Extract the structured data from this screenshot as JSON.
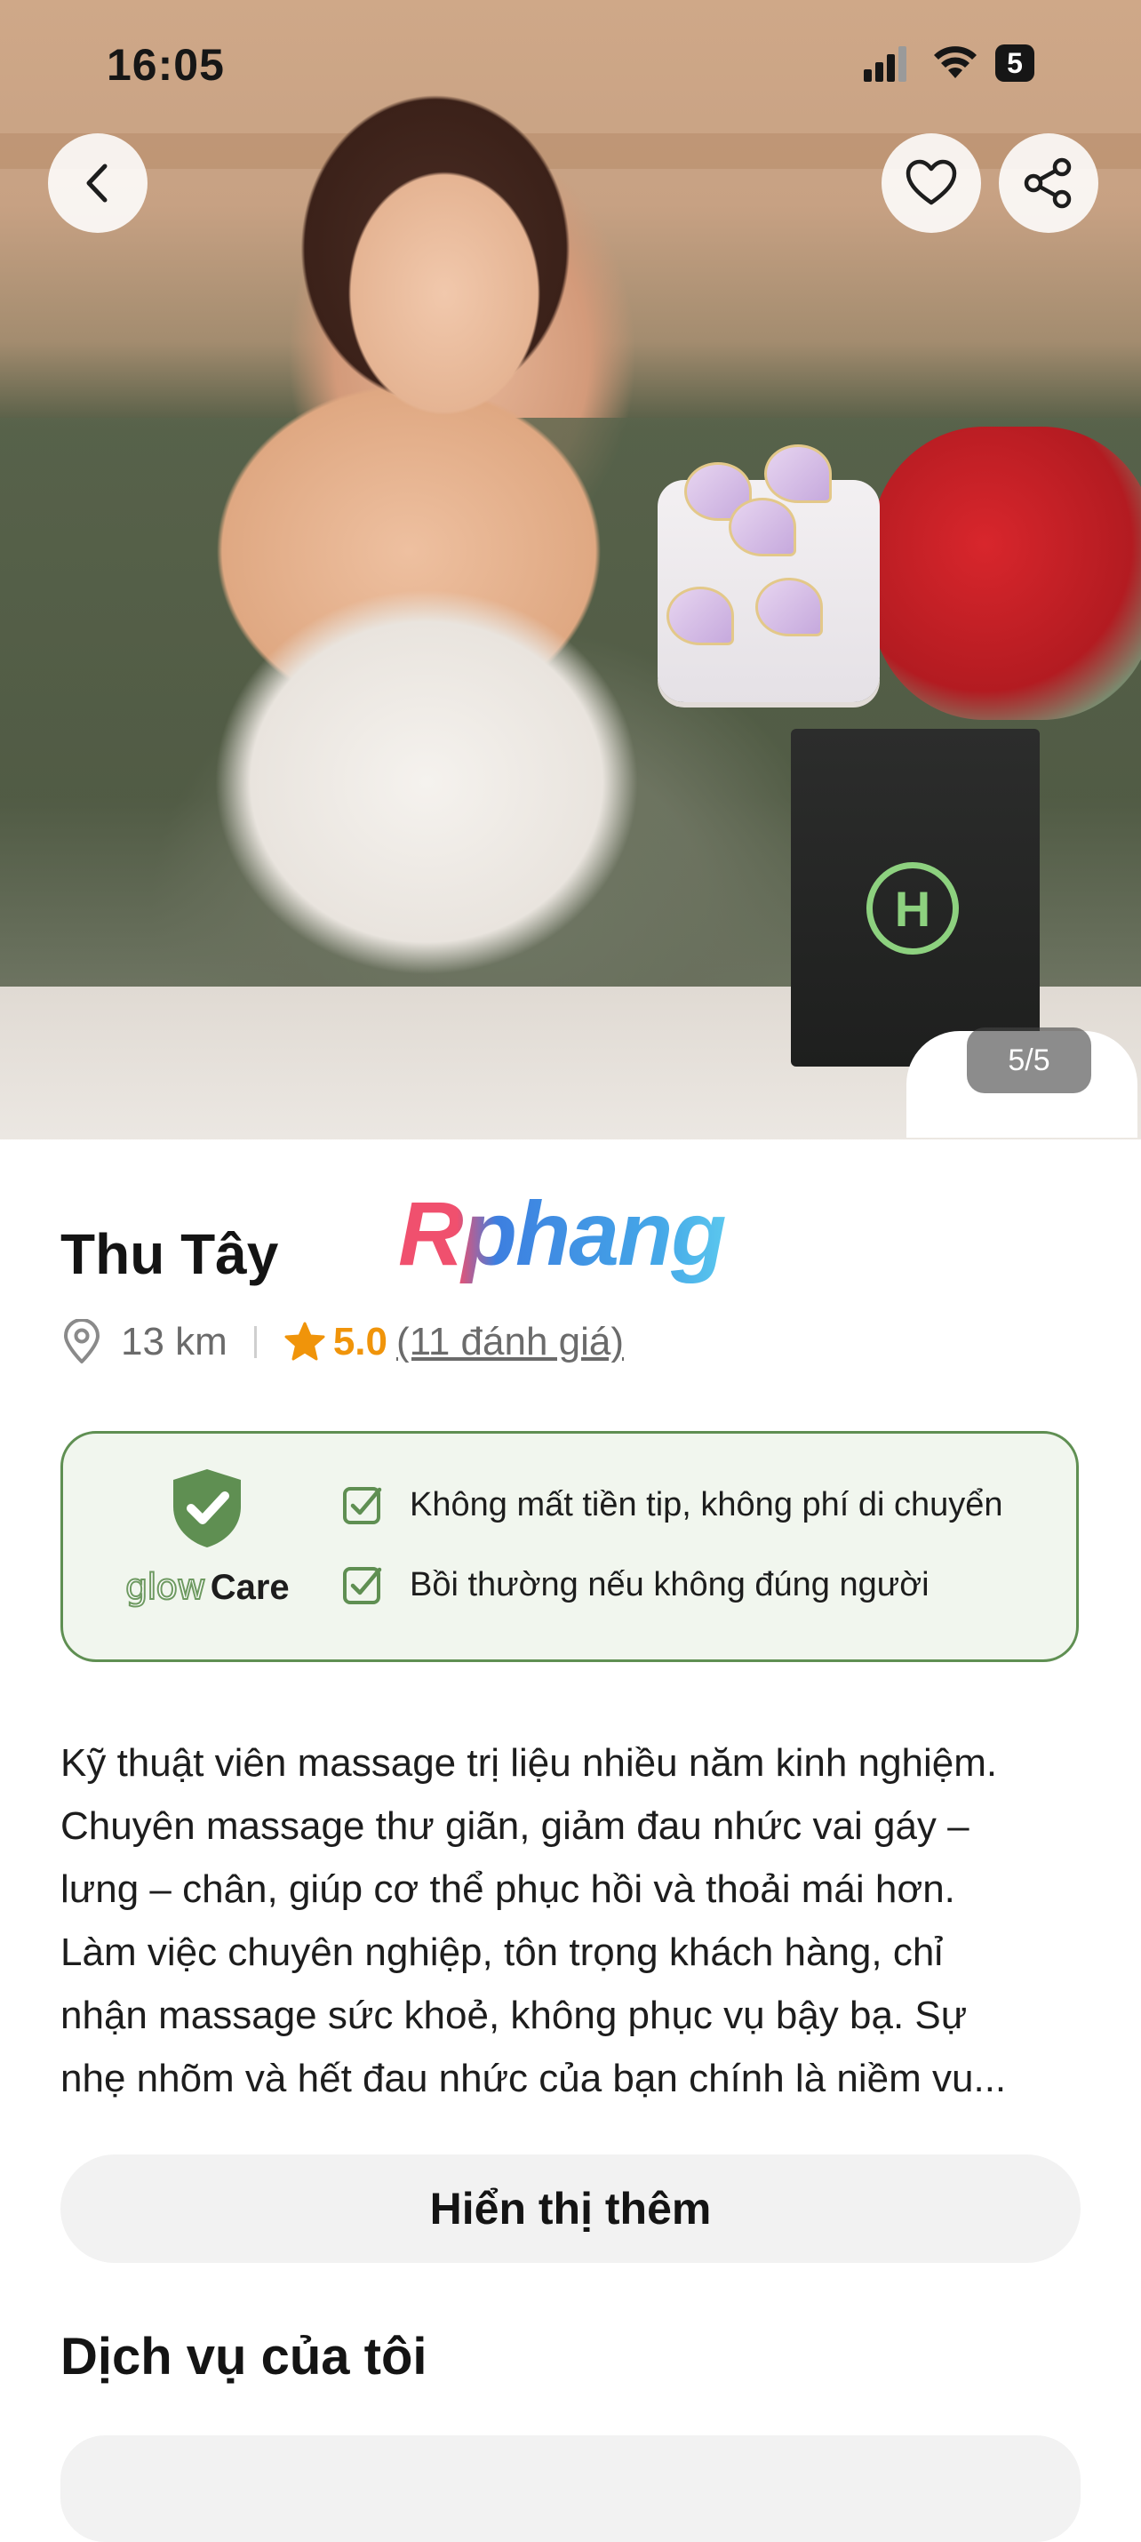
{
  "status_bar": {
    "time": "16:05",
    "battery": "5"
  },
  "gallery": {
    "counter": "5/5"
  },
  "profile": {
    "name": "Thu Tây",
    "watermark": "Rphang",
    "distance": "13 km",
    "rating": "5.0",
    "reviews": "(11 đánh giá)"
  },
  "glow_care": {
    "brand_glow": "glow",
    "brand_care": "Care",
    "benefits": [
      "Không mất tiền tip, không phí di chuyển",
      "Bồi thường nếu không đúng người"
    ]
  },
  "description": {
    "lines": [
      "Kỹ thuật viên massage trị liệu nhiều năm kinh nghiệm.",
      "Chuyên massage thư giãn, giảm đau nhức vai gáy –",
      "lưng – chân, giúp cơ thể phục hồi và thoải mái hơn.",
      "Làm việc chuyên nghiệp, tôn trọng khách hàng, chỉ",
      "nhận massage sức khoẻ, không phục vụ bậy bạ. Sự",
      "nhẹ nhõm và hết đau nhức của bạn chính là niềm vu..."
    ]
  },
  "show_more_label": "Hiển thị thêm",
  "services_title": "Dịch vụ của tôi",
  "colors": {
    "accent_green": "#5f8f52",
    "rating_orange": "#f0940a",
    "card_bg": "#f1f6ee"
  },
  "icons": [
    "back-icon",
    "heart-icon",
    "share-icon",
    "location-pin-icon",
    "star-icon",
    "shield-check-icon",
    "checkbox-icon"
  ]
}
